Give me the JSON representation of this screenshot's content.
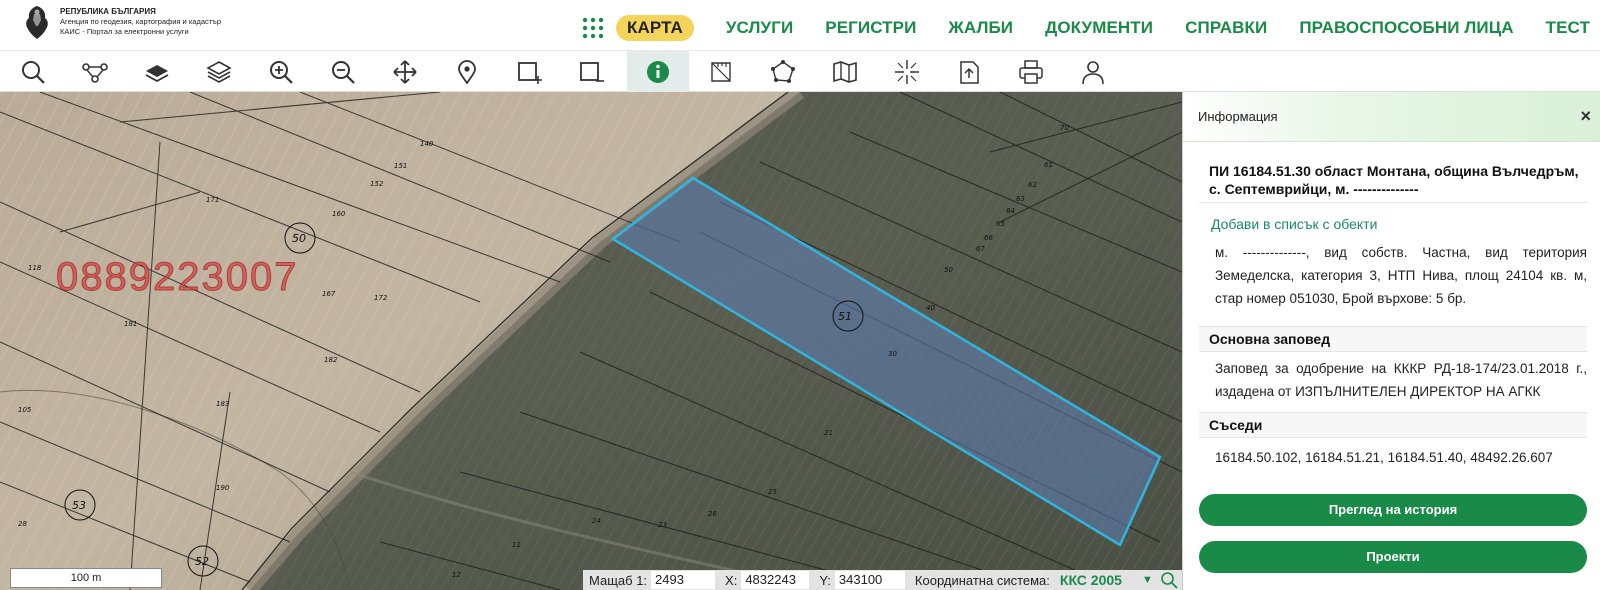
{
  "header": {
    "logo_line1": "РЕПУБЛИКА БЪЛГАРИЯ",
    "logo_line2": "Агенция по геодезия, картография и кадастър",
    "logo_line3": "КАИС - Портал за електронни услуги",
    "nav": [
      "КАРТА",
      "УСЛУГИ",
      "РЕГИСТРИ",
      "ЖАЛБИ",
      "ДОКУМЕНТИ",
      "СПРАВКИ",
      "ПРАВОСПОСОБНИ ЛИЦА",
      "ТЕСТ"
    ]
  },
  "toolbar": {
    "tools": [
      "search-icon",
      "route-icon",
      "layer-icon",
      "layers-icon",
      "zoom-in-icon",
      "zoom-out-icon",
      "pan-icon",
      "location-pin-icon",
      "select-add-icon",
      "select-remove-icon",
      "info-icon",
      "measure-icon",
      "polygon-icon",
      "map-icon",
      "crosshair-icon",
      "export-icon",
      "print-icon",
      "user-icon"
    ],
    "active": "info-icon"
  },
  "map": {
    "watermark": "0889223007",
    "scale_label": "100 m",
    "parcel_labels": [
      "140",
      "151",
      "152",
      "171",
      "160",
      "50",
      "118",
      "167",
      "172",
      "181",
      "182",
      "183",
      "105",
      "190",
      "53",
      "28",
      "52",
      "11",
      "12",
      "24",
      "23",
      "26",
      "25",
      "21",
      "30",
      "51",
      "40",
      "50",
      "61",
      "62",
      "63",
      "64",
      "65",
      "66",
      "67",
      "70"
    ],
    "accent": "#2fb6e0"
  },
  "status": {
    "scale_label": "Мащаб 1:",
    "scale_value": "2493",
    "x_label": "X:",
    "x_value": "4832243",
    "y_label": "Y:",
    "y_value": "343100",
    "crs_label": "Координатна система:",
    "crs_value": "ККС 2005",
    "dropdown": "▼"
  },
  "panel": {
    "title": "Информация",
    "close": "×",
    "object_title": "ПИ 16184.51.30 област Монтана, община Вълчедръм, с. Септемврийци, м. --------------",
    "add_link": "Добави в списък с обекти",
    "description": "м. --------------, вид собств. Частна, вид територия Земеделска, категория 3, НТП Нива, площ 24104 кв. м, стар номер 051030, Брой върхове: 5 бр.",
    "order_heading": "Основна заповед",
    "order_text": "Заповед за одобрение на КККР РД-18-174/23.01.2018 г., издадена от ИЗПЪЛНИТЕЛЕН ДИРЕКТОР НА АГКК",
    "neighbors_heading": "Съседи",
    "neighbors_text": "16184.50.102, 16184.51.21, 16184.51.40, 48492.26.607",
    "history_button": "Преглед на история",
    "projects_button": "Проекти"
  },
  "colors": {
    "brand_green": "#1a8a48",
    "active_nav": "#f4d45a"
  }
}
